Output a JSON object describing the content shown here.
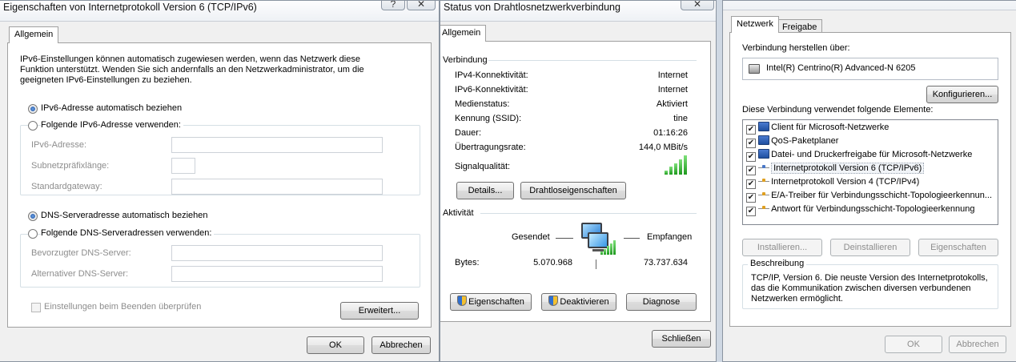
{
  "win1": {
    "title": "Eigenschaften von Internetprotokoll Version 6 (TCP/IPv6)",
    "help_glyph": "?",
    "close_glyph": "✕",
    "tab": "Allgemein",
    "intro": "IPv6-Einstellungen können automatisch zugewiesen werden, wenn das Netzwerk diese Funktion unterstützt. Wenden Sie sich andernfalls an den Netzwerkadministrator, um die geeigneten IPv6-Einstellungen zu beziehen.",
    "radio_auto_addr": "IPv6-Adresse automatisch beziehen",
    "radio_manual_addr": "Folgende IPv6-Adresse verwenden:",
    "label_addr": "IPv6-Adresse:",
    "label_prefix": "Subnetzpräfixlänge:",
    "label_gateway": "Standardgateway:",
    "radio_auto_dns": "DNS-Serveradresse automatisch beziehen",
    "radio_manual_dns": "Folgende DNS-Serveradressen verwenden:",
    "label_dns1": "Bevorzugter DNS-Server:",
    "label_dns2": "Alternativer DNS-Server:",
    "check_validate": "Einstellungen beim Beenden überprüfen",
    "btn_advanced": "Erweitert...",
    "btn_ok": "OK",
    "btn_cancel": "Abbrechen"
  },
  "win2": {
    "title": "Status von Drahtlosnetzwerkverbindung",
    "close_glyph": "✕",
    "tab": "Allgemein",
    "section_connection": "Verbindung",
    "rows": [
      {
        "label": "IPv4-Konnektivität:",
        "value": "Internet"
      },
      {
        "label": "IPv6-Konnektivität:",
        "value": "Internet"
      },
      {
        "label": "Medienstatus:",
        "value": "Aktiviert"
      },
      {
        "label": "Kennung (SSID):",
        "value": "tine"
      },
      {
        "label": "Dauer:",
        "value": "01:16:26"
      },
      {
        "label": "Übertragungsrate:",
        "value": "144,0 MBit/s"
      }
    ],
    "signal_label": "Signalqualität:",
    "signal_level": 5,
    "btn_details": "Details...",
    "btn_wireless": "Drahtloseigenschaften",
    "section_activity": "Aktivität",
    "sent_label": "Gesendet",
    "received_label": "Empfangen",
    "bytes_label": "Bytes:",
    "bytes_sent": "5.070.968",
    "bytes_received": "73.737.634",
    "btn_properties": "Eigenschaften",
    "btn_deactivate": "Deaktivieren",
    "btn_diagnose": "Diagnose",
    "btn_close": "Schließen"
  },
  "win3": {
    "tab_network": "Netzwerk",
    "tab_sharing": "Freigabe",
    "connect_via_label": "Verbindung herstellen über:",
    "adapter_name": "Intel(R) Centrino(R) Advanced-N 6205",
    "btn_configure": "Konfigurieren...",
    "elements_label": "Diese Verbindung verwendet folgende Elemente:",
    "items": [
      {
        "label": "Client für Microsoft-Netzwerke",
        "checked": true,
        "icon": "network-client-icon"
      },
      {
        "label": "QoS-Paketplaner",
        "checked": true,
        "icon": "qos-icon"
      },
      {
        "label": "Datei- und Druckerfreigabe für Microsoft-Netzwerke",
        "checked": true,
        "icon": "file-share-icon"
      },
      {
        "label": "Internetprotokoll Version 6 (TCP/IPv6)",
        "checked": true,
        "icon": "protocol-icon"
      },
      {
        "label": "Internetprotokoll Version 4 (TCP/IPv4)",
        "checked": true,
        "icon": "protocol-icon"
      },
      {
        "label": "E/A-Treiber für Verbindungsschicht-Topologieerkennun...",
        "checked": true,
        "icon": "protocol-icon"
      },
      {
        "label": "Antwort für Verbindungsschicht-Topologieerkennung",
        "checked": true,
        "icon": "protocol-icon"
      }
    ],
    "btn_install": "Installieren...",
    "btn_uninstall": "Deinstallieren",
    "btn_properties": "Eigenschaften",
    "description_label": "Beschreibung",
    "description_text": "TCP/IP, Version 6. Die neuste Version des Internetprotokolls, das die Kommunikation zwischen diversen verbundenen Netzwerken ermöglicht.",
    "btn_ok": "OK",
    "btn_cancel": "Abbrechen"
  },
  "checkmark": "✔"
}
